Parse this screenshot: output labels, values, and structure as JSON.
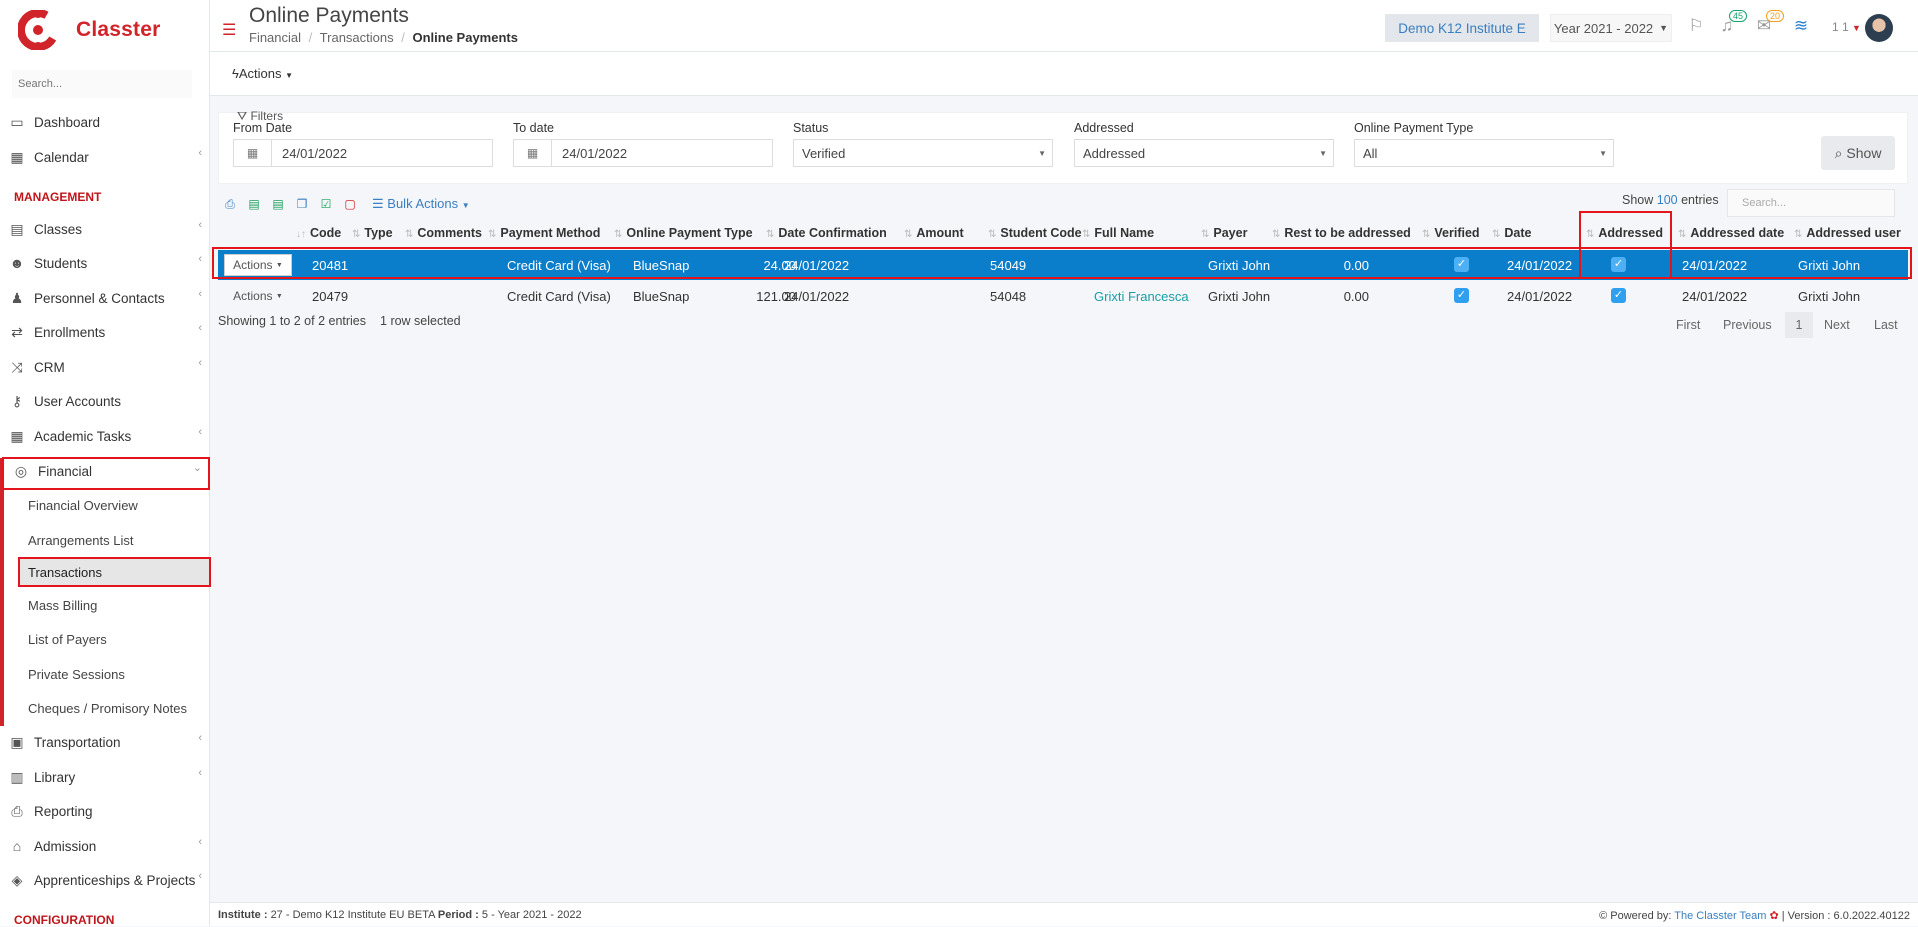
{
  "app": {
    "name": "Classter",
    "search_placeholder": "Search..."
  },
  "sidebar": {
    "items": [
      {
        "label": "Dashboard"
      },
      {
        "label": "Calendar"
      },
      {
        "label": "Classes"
      },
      {
        "label": "Students"
      },
      {
        "label": "Personnel & Contacts"
      },
      {
        "label": "Enrollments"
      },
      {
        "label": "CRM"
      },
      {
        "label": "User Accounts"
      },
      {
        "label": "Academic Tasks"
      },
      {
        "label": "Financial"
      },
      {
        "label": "Transportation"
      },
      {
        "label": "Library"
      },
      {
        "label": "Reporting"
      },
      {
        "label": "Admission"
      },
      {
        "label": "Apprenticeships & Projects"
      }
    ],
    "sections": {
      "management": "MANAGEMENT",
      "configuration": "CONFIGURATION"
    },
    "financial_sub": [
      {
        "label": "Financial Overview"
      },
      {
        "label": "Arrangements List"
      },
      {
        "label": "Transactions"
      },
      {
        "label": "Mass Billing"
      },
      {
        "label": "List of Payers"
      },
      {
        "label": "Private Sessions"
      },
      {
        "label": "Cheques / Promisory Notes"
      }
    ]
  },
  "header": {
    "title": "Online Payments",
    "breadcrumb": [
      "Financial",
      "/",
      "Transactions",
      "/",
      "Online Payments"
    ],
    "institute": "Demo K12 Institute E",
    "year": "Year 2021 - 2022",
    "notifications": "45",
    "messages": "20",
    "user": "1 1"
  },
  "toolbar": {
    "actions": "Actions"
  },
  "filters": {
    "title": "Filters",
    "from_date_label": "From Date",
    "from_date": "24/01/2022",
    "to_date_label": "To date",
    "to_date": "24/01/2022",
    "status_label": "Status",
    "status": "Verified",
    "addressed_label": "Addressed",
    "addressed": "Addressed",
    "type_label": "Online Payment Type",
    "type": "All",
    "show_button": "Show"
  },
  "table": {
    "bulk_actions": "Bulk Actions",
    "show_label": "Show",
    "show_count": "100",
    "entries_label": "entries",
    "search_placeholder": "Search...",
    "columns": [
      "Code",
      "Type",
      "Comments",
      "Payment Method",
      "Online Payment Type",
      "Date Confirmation",
      "Amount",
      "Student Code",
      "Full Name",
      "Payer",
      "Rest to be addressed",
      "Verified",
      "Date",
      "Addressed",
      "Addressed date",
      "Addressed user"
    ],
    "rows": [
      {
        "actions": "Actions",
        "code": "20481",
        "type": "",
        "comments": "",
        "method": "Credit Card (Visa)",
        "online_type": "BlueSnap",
        "date_conf": "24/01/2022",
        "amount": "24.00",
        "student_code": "54049",
        "full_name": "",
        "payer": "Grixti John",
        "rest": "0.00",
        "verified": true,
        "date": "24/01/2022",
        "addressed": true,
        "addressed_date": "24/01/2022",
        "addressed_user": "Grixti John",
        "selected": true
      },
      {
        "actions": "Actions",
        "code": "20479",
        "type": "",
        "comments": "",
        "method": "Credit Card (Visa)",
        "online_type": "BlueSnap",
        "date_conf": "24/01/2022",
        "amount": "121.00",
        "student_code": "54048",
        "full_name": "Grixti Francesca",
        "payer": "Grixti John",
        "rest": "0.00",
        "verified": true,
        "date": "24/01/2022",
        "addressed": true,
        "addressed_date": "24/01/2022",
        "addressed_user": "Grixti John",
        "selected": false
      }
    ],
    "info": "Showing 1 to 2 of 2 entries",
    "selected_info": "1 row selected",
    "pager": {
      "first": "First",
      "previous": "Previous",
      "current": "1",
      "next": "Next",
      "last": "Last"
    }
  },
  "footer": {
    "institute_label": "Institute :",
    "institute": "27 - Demo K12 Institute EU BETA",
    "period_label": "Period :",
    "period": "5 - Year 2021 - 2022",
    "powered": "Powered by:",
    "team": "The Classter Team",
    "version": "| Version : 6.0.2022.40122"
  }
}
